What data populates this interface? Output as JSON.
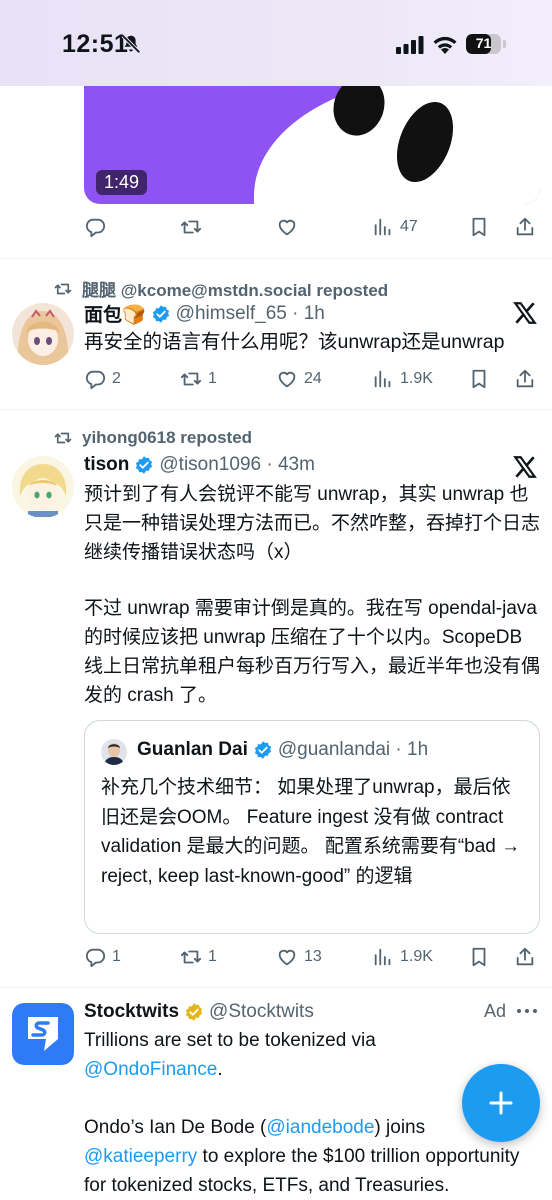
{
  "status_bar": {
    "time": "12:51",
    "battery": "71",
    "battery_level": 0.71
  },
  "top_video": {
    "duration": "1:49",
    "views": "47"
  },
  "tweet1": {
    "repost_by": "腿腿 @kcome@mstdn.social reposted",
    "name": "面包🍞",
    "handle_time": "@himself_65 · 1h",
    "text": "再安全的语言有什么用呢？该unwrap还是unwrap",
    "replies": "2",
    "reposts": "1",
    "likes": "24",
    "views": "1.9K"
  },
  "tweet2": {
    "repost_by": "yihong0618 reposted",
    "name": "tison",
    "handle_time": "@tison1096 · 43m",
    "text_p1": "预计到了有人会锐评不能写 unwrap，其实 unwrap 也只是一种错误处理方法而已。不然咋整，吞掉打个日志继续传播错误状态吗（x）",
    "text_p2": "不过 unwrap 需要审计倒是真的。我在写 opendal-java 的时候应该把 unwrap 压缩在了十个以内。ScopeDB 线上日常抗单租户每秒百万行写入，最近半年也没有偶发的 crash 了。",
    "quote": {
      "name": "Guanlan Dai",
      "handle_time": "@guanlandai · 1h",
      "text": "补充几个技术细节： 如果处理了unwrap，最后依旧还是会OOM。 Feature ingest 没有做 contract validation 是最大的问题。 配置系统需要有“bad → reject, keep last-known-good” 的逻辑"
    },
    "replies": "1",
    "reposts": "1",
    "likes": "13",
    "views": "1.9K"
  },
  "ad": {
    "name": "Stocktwits",
    "handle": "@Stocktwits",
    "label": "Ad",
    "line1": "Trillions are set to be tokenized via",
    "mention1": "@OndoFinance",
    "after_mention1": ".",
    "para2_a": "Ondo’s Ian De Bode (",
    "mention2": "@iandebode",
    "para2_b": ") joins",
    "mention3": "@katieeperry",
    "para2_c": " to explore the $100 trillion opportunity for tokenized stocks, ETFs, and Treasuries."
  },
  "colors": {
    "accent": "#1d9bf0",
    "muted": "#536471",
    "gold_check": "#e2b719",
    "video_purple": "#8e53f2"
  },
  "icons": [
    "bell-slash-icon",
    "signal-icon",
    "wifi-icon",
    "battery-icon",
    "reply-icon",
    "repost-icon",
    "like-icon",
    "views-icon",
    "bookmark-icon",
    "share-icon",
    "verified-icon",
    "x-logo-icon",
    "more-icon",
    "compose-plus-icon"
  ]
}
